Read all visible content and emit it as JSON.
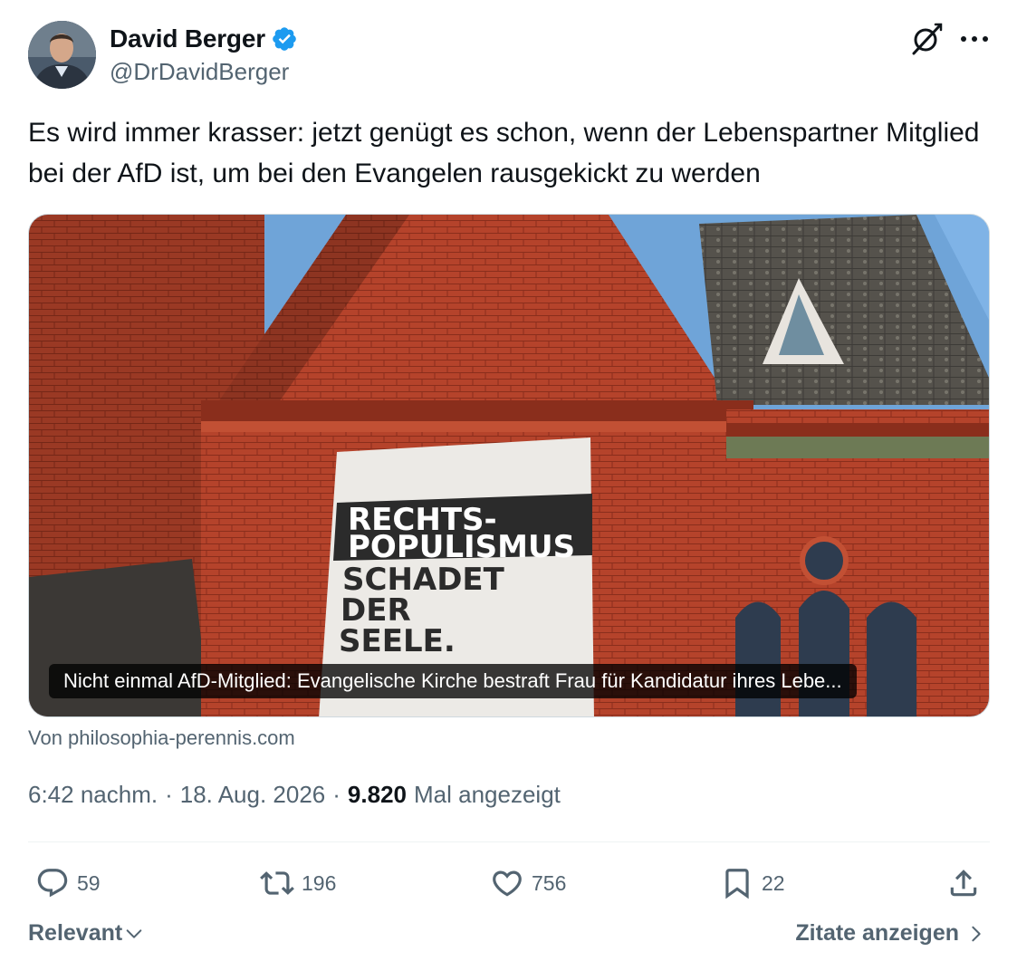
{
  "author": {
    "display_name": "David Berger",
    "handle": "@DrDavidBerger",
    "verified": true,
    "avatar": "avatar-photo"
  },
  "tweet": {
    "text": "Es wird immer krasser: jetzt genügt es schon, wenn der Lebenspartner Mitglied bei der AfD ist, um bei den Evangelen rausgekickt zu werden"
  },
  "card": {
    "caption": "Nicht einmal AfD-Mitglied: Evangelische Kirche bestraft Frau für Kandidatur ihres Lebe...",
    "banner_lines": [
      "RECHTS-",
      "POPULISMUS",
      "SCHADET",
      "DER",
      "SEELE."
    ],
    "source": "Von philosophia-perennis.com"
  },
  "meta": {
    "time": "6:42 nachm.",
    "sep1": "·",
    "date": "18. Aug. 2026",
    "sep2": "·",
    "views": "9.820",
    "views_label": "Mal angezeigt"
  },
  "actions": {
    "replies": "59",
    "reposts": "196",
    "likes": "756",
    "bookmarks": "22"
  },
  "footer": {
    "sort_label": "Relevant",
    "quotes_label": "Zitate anzeigen"
  },
  "colors": {
    "verified_blue": "#1d9bf0",
    "secondary_text": "#536471",
    "primary_text": "#0f1419",
    "brick": "#b5422a"
  },
  "icons": [
    "verified-badge-icon",
    "grok-icon",
    "more-icon",
    "reply-icon",
    "repost-icon",
    "like-icon",
    "bookmark-icon",
    "share-icon",
    "chevron-down-icon",
    "chevron-right-icon"
  ]
}
